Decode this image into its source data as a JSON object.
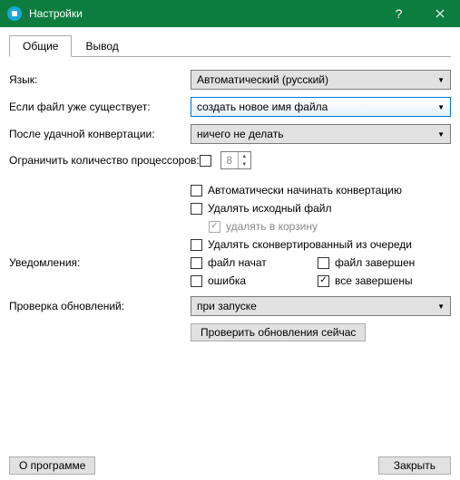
{
  "titlebar": {
    "title": "Настройки"
  },
  "tabs": {
    "general": "Общие",
    "output": "Вывод"
  },
  "labels": {
    "language": "Язык:",
    "file_exists": "Если файл уже существует:",
    "after_conv": "После удачной конвертации:",
    "limit_cpu": "Ограничить количество процессоров:",
    "notifications": "Уведомления:",
    "updates": "Проверка обновлений:"
  },
  "values": {
    "language": "Автоматический (русский)",
    "file_exists": "создать новое имя файла",
    "after_conv": "ничего не делать",
    "cpu_count": "8",
    "updates": "при запуске"
  },
  "checks": {
    "auto_start": "Автоматически начинать конвертацию",
    "delete_source": "Удалять исходный файл",
    "delete_recycle": "удалять в корзину",
    "remove_queue": "Удалять сконвертированный из очереди",
    "file_started": "файл начат",
    "file_finished": "файл завершен",
    "error": "ошибка",
    "all_finished": "все завершены"
  },
  "buttons": {
    "check_now": "Проверить обновления сейчас",
    "about": "О программе",
    "close": "Закрыть"
  }
}
